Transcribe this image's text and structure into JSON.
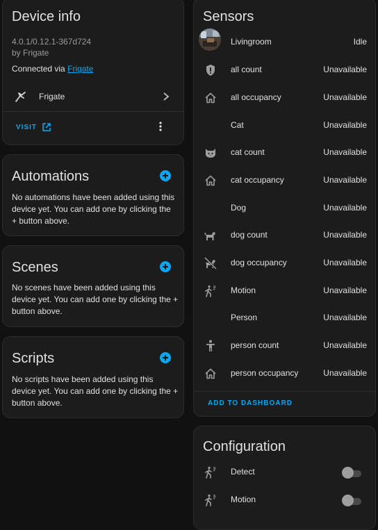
{
  "device_info": {
    "title": "Device info",
    "version": "4.0.1/0.12.1-367d724",
    "by": "by Frigate",
    "connected_prefix": "Connected via ",
    "connected_link": "Frigate",
    "integration_name": "Frigate",
    "visit_label": "VISIT"
  },
  "automations": {
    "title": "Automations",
    "empty_text": "No automations have been added using this device yet. You can add one by clicking the + button above."
  },
  "scenes": {
    "title": "Scenes",
    "empty_text": "No scenes have been added using this device yet. You can add one by clicking the + button above."
  },
  "scripts": {
    "title": "Scripts",
    "empty_text": "No scripts have been added using this device yet. You can add one by clicking the + button above."
  },
  "sensors": {
    "title": "Sensors",
    "items": [
      {
        "name": "Livingroom",
        "state": "Idle",
        "icon": "camera-thumbnail"
      },
      {
        "name": "all count",
        "state": "Unavailable",
        "icon": "shield-alert-icon"
      },
      {
        "name": "all occupancy",
        "state": "Unavailable",
        "icon": "home-outline-icon"
      },
      {
        "name": "Cat",
        "state": "Unavailable",
        "icon": ""
      },
      {
        "name": "cat count",
        "state": "Unavailable",
        "icon": "cat-icon"
      },
      {
        "name": "cat occupancy",
        "state": "Unavailable",
        "icon": "home-outline-icon"
      },
      {
        "name": "Dog",
        "state": "Unavailable",
        "icon": ""
      },
      {
        "name": "dog count",
        "state": "Unavailable",
        "icon": "dog-icon"
      },
      {
        "name": "dog occupancy",
        "state": "Unavailable",
        "icon": "dog-off-icon"
      },
      {
        "name": "Motion",
        "state": "Unavailable",
        "icon": "motion-sensor-icon"
      },
      {
        "name": "Person",
        "state": "Unavailable",
        "icon": ""
      },
      {
        "name": "person count",
        "state": "Unavailable",
        "icon": "person-icon"
      },
      {
        "name": "person occupancy",
        "state": "Unavailable",
        "icon": "home-outline-icon"
      }
    ],
    "add_to_dashboard_label": "ADD TO DASHBOARD"
  },
  "configuration": {
    "title": "Configuration",
    "items": [
      {
        "name": "Detect",
        "icon": "motion-sensor-icon",
        "on": false
      },
      {
        "name": "Motion",
        "icon": "motion-sensor-icon",
        "on": false
      }
    ]
  },
  "colors": {
    "accent": "#03a9f4",
    "card_bg": "#1c1c1c",
    "page_bg": "#111111",
    "icon_gray": "#9e9e9e"
  }
}
